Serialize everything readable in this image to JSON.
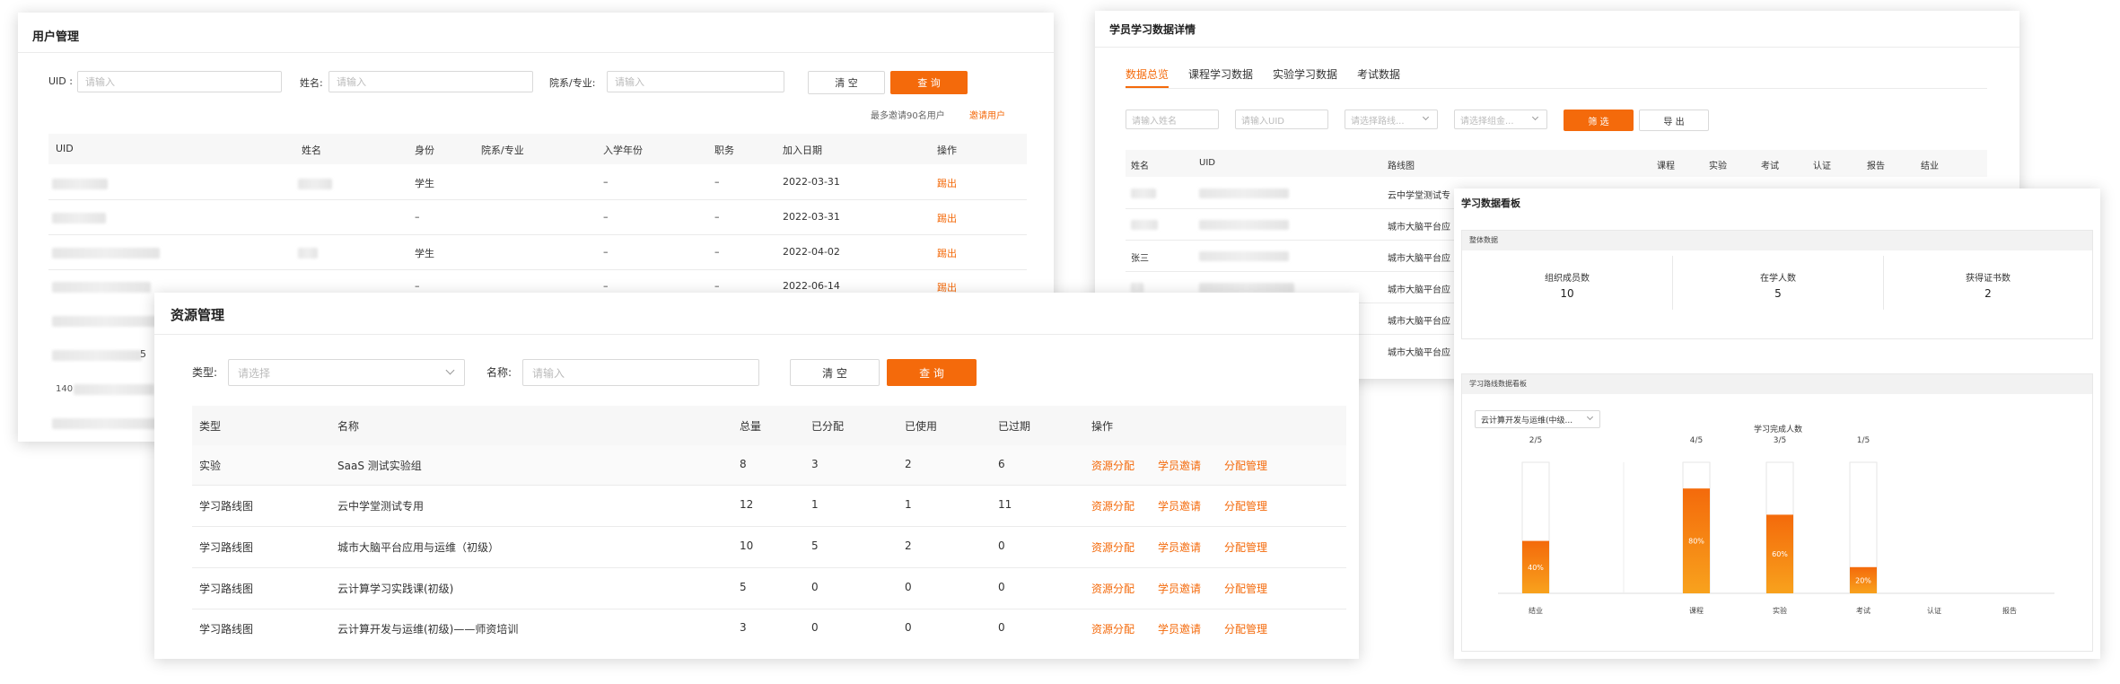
{
  "users": {
    "title": "用户管理",
    "filters": {
      "uid_label": "UID :",
      "uid_ph": "请输入",
      "name_label": "姓名:",
      "name_ph": "请输入",
      "dept_label": "院系/专业:",
      "dept_ph": "请输入",
      "clear": "清 空",
      "query": "查 询"
    },
    "invite_note": "最多邀请90名用户",
    "invite_link": "邀请用户",
    "columns": [
      "UID",
      "姓名",
      "身份",
      "院系/专业",
      "入学年份",
      "职务",
      "加入日期",
      "操作"
    ],
    "rows": [
      {
        "role": "学生",
        "year": "–",
        "job": "–",
        "date": "2022-03-31",
        "action": "踢出"
      },
      {
        "role": "–",
        "year": "–",
        "job": "–",
        "date": "2022-03-31",
        "action": "踢出"
      },
      {
        "role": "学生",
        "year": "–",
        "job": "–",
        "date": "2022-04-02",
        "action": "踢出"
      },
      {
        "role": "–",
        "year": "–",
        "job": "–",
        "date": "2022-06-14",
        "action": "踢出"
      }
    ],
    "partial_texts": [
      "5",
      "140"
    ]
  },
  "resources": {
    "title": "资源管理",
    "type_label": "类型:",
    "type_ph": "请选择",
    "name_label": "名称:",
    "name_ph": "请输入",
    "clear": "清 空",
    "query": "查 询",
    "columns": [
      "类型",
      "名称",
      "总量",
      "已分配",
      "已使用",
      "已过期",
      "操作"
    ],
    "rows": [
      {
        "type": "实验",
        "name": "SaaS 测试实验组",
        "total": "8",
        "assigned": "3",
        "used": "2",
        "expired": "6"
      },
      {
        "type": "学习路线图",
        "name": "云中学堂测试专用",
        "total": "12",
        "assigned": "1",
        "used": "1",
        "expired": "11"
      },
      {
        "type": "学习路线图",
        "name": "城市大脑平台应用与运维（初级）",
        "total": "10",
        "assigned": "5",
        "used": "2",
        "expired": "0"
      },
      {
        "type": "学习路线图",
        "name": "云计算学习实践课(初级)",
        "total": "5",
        "assigned": "0",
        "used": "0",
        "expired": "0"
      },
      {
        "type": "学习路线图",
        "name": "云计算开发与运维(初级)——师资培训",
        "total": "3",
        "assigned": "0",
        "used": "0",
        "expired": "0"
      }
    ],
    "actions": [
      "资源分配",
      "学员邀请",
      "分配管理"
    ]
  },
  "learner": {
    "title": "学员学习数据详情",
    "tabs": [
      "数据总览",
      "课程学习数据",
      "实验学习数据",
      "考试数据"
    ],
    "filters": {
      "name_ph": "请输入姓名",
      "uid_ph": "请输入UID",
      "route_ph": "请选择路线...",
      "group_ph": "请选择组金...",
      "filter": "筛 选",
      "export": "导 出"
    },
    "columns": [
      "姓名",
      "UID",
      "路线图",
      "课程",
      "实验",
      "考试",
      "认证",
      "报告",
      "结业"
    ],
    "rows": [
      {
        "name": "",
        "route": "云中学堂测试专"
      },
      {
        "name": "",
        "route": "城市大脑平台应"
      },
      {
        "name": "张三",
        "route": "城市大脑平台应"
      },
      {
        "name": "",
        "route": "城市大脑平台应"
      },
      {
        "name": "",
        "route": "城市大脑平台应"
      },
      {
        "name": "",
        "route": "城市大脑平台应"
      }
    ]
  },
  "dashboard": {
    "title": "学习数据看板",
    "overall": {
      "title": "整体数据",
      "stats": [
        {
          "label": "组织成员数",
          "value": "10"
        },
        {
          "label": "在学人数",
          "value": "5"
        },
        {
          "label": "获得证书数",
          "value": "2"
        }
      ]
    },
    "route_board": {
      "title": "学习路线数据看板",
      "select_value": "云计算开发与运维(中级...",
      "chart_title": "学习完成人数"
    },
    "colors": {
      "bar_top": "#f46a0b",
      "bar_bottom": "#f8a21d",
      "empty": "#ffffff",
      "accent": "#f46a0b"
    }
  },
  "chart_data": {
    "type": "bar",
    "title": "学习完成人数",
    "categories": [
      "结业",
      "课程",
      "实验",
      "考试",
      "认证",
      "报告"
    ],
    "counts": [
      "2/5",
      "4/5",
      "3/5",
      "1/5",
      "",
      ""
    ],
    "values": [
      40,
      80,
      60,
      20,
      null,
      null
    ],
    "labels": [
      "40%",
      "80%",
      "60%",
      "20%",
      "",
      ""
    ],
    "ylim": [
      0,
      100
    ]
  }
}
